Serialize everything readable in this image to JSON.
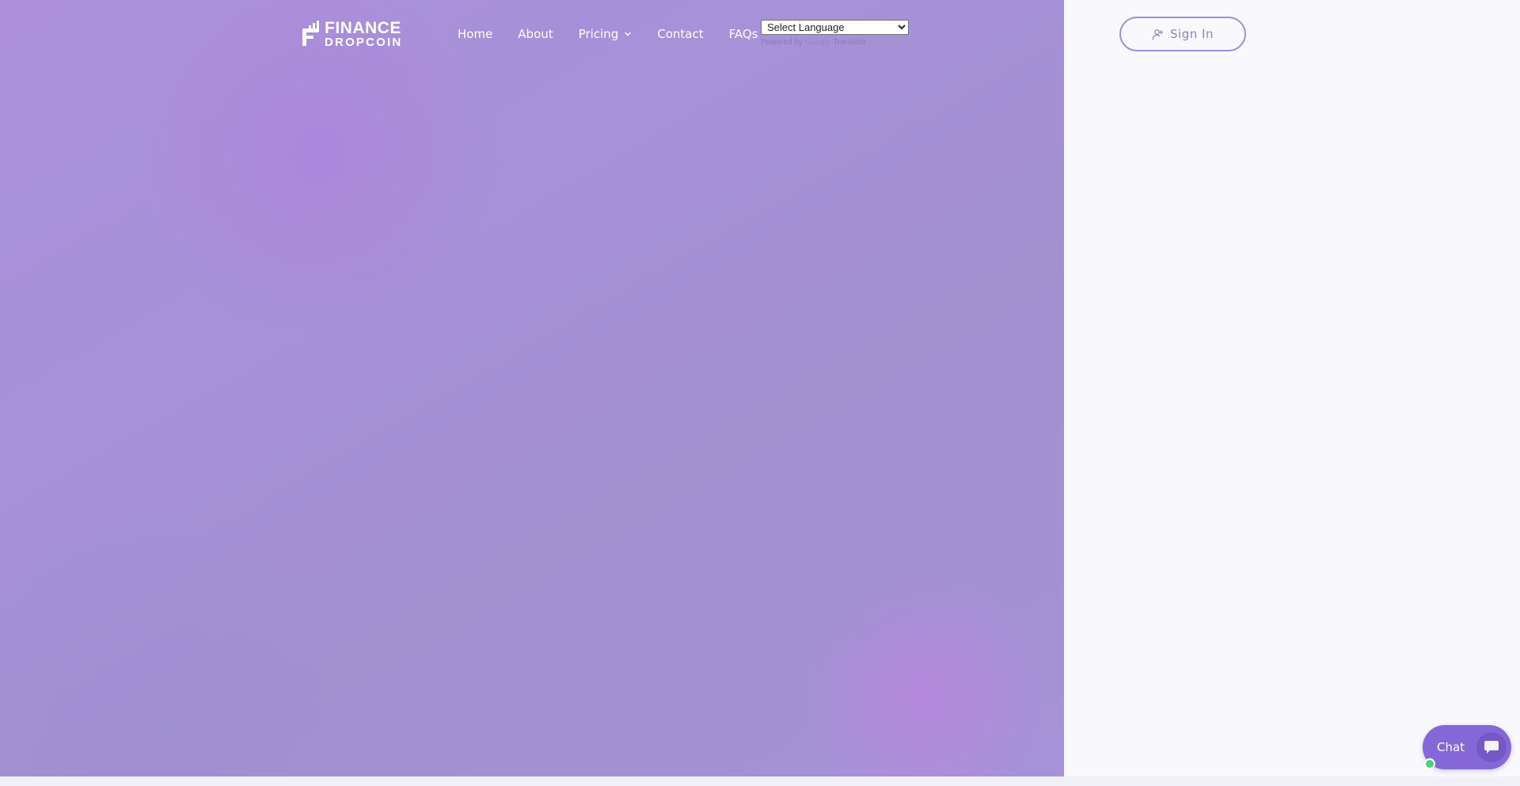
{
  "brand": {
    "line1": "FINANCE",
    "line2": "DROPCOIN"
  },
  "nav": {
    "items": [
      "Home",
      "About",
      "Pricing",
      "Contact",
      "FAQs"
    ]
  },
  "translate": {
    "selected": "Select Language",
    "powered_by": "Powered by",
    "google": "Google",
    "translate_word": "Translate"
  },
  "signin": {
    "label": "Sign In"
  },
  "chat": {
    "label": "Chat"
  },
  "icons": {
    "signin": "user-plus-icon",
    "pricing_dropdown": "chevron-down-icon",
    "chat": "speech-bubble-icon",
    "status": "online-dot-icon"
  },
  "colors": {
    "hero": "#a791d8",
    "signin_border": "#a08ed8",
    "chat": "#8567d8",
    "online": "#4cd37a"
  }
}
